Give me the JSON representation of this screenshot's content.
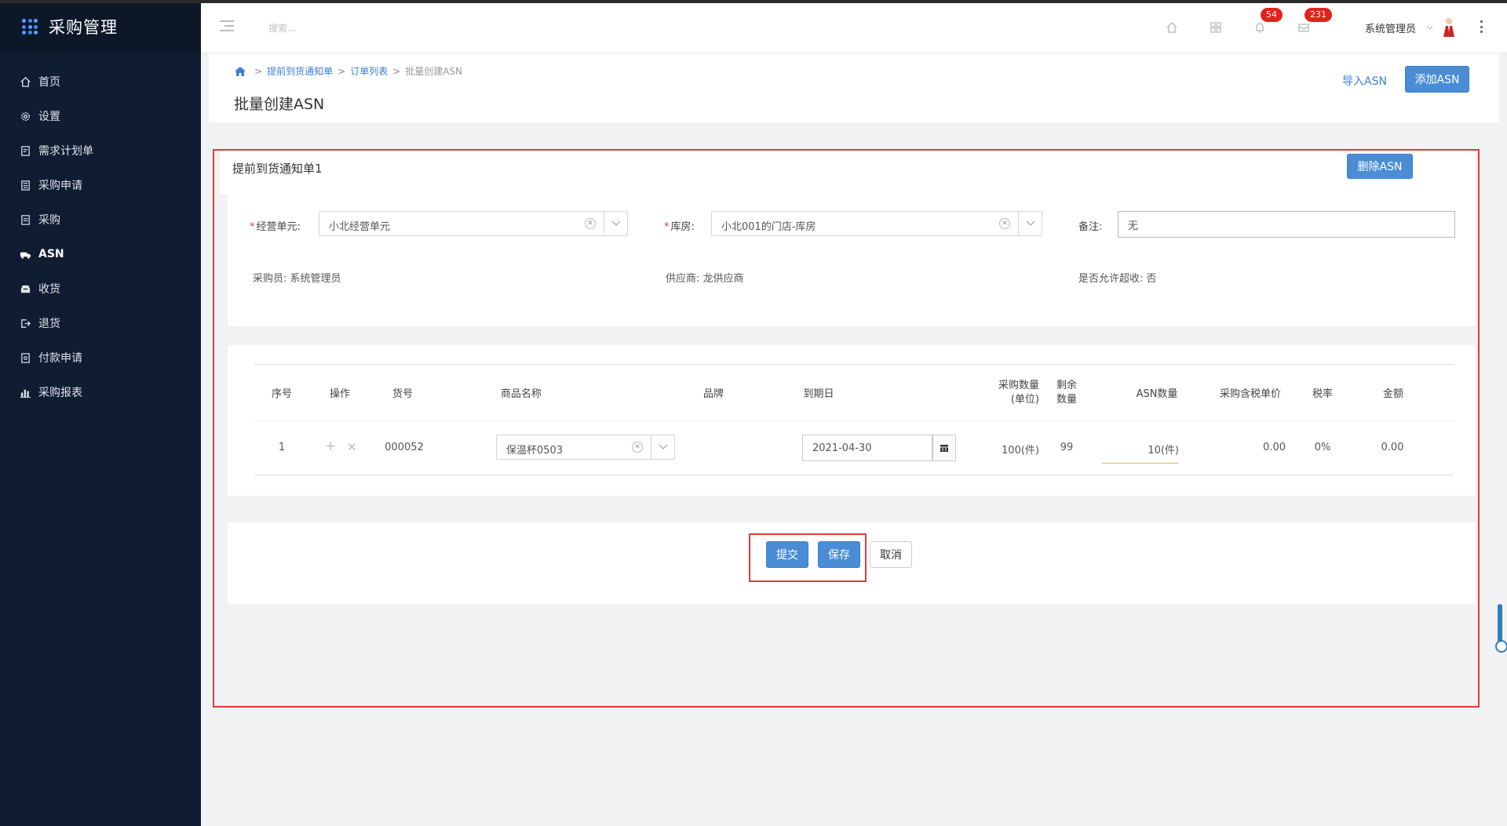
{
  "app": {
    "title": "采购管理"
  },
  "sidebar": {
    "items": [
      {
        "label": "首页",
        "icon": "home-icon"
      },
      {
        "label": "设置",
        "icon": "gear-icon"
      },
      {
        "label": "需求计划单",
        "icon": "edit-doc-icon"
      },
      {
        "label": "采购申请",
        "icon": "list-doc-icon"
      },
      {
        "label": "采购",
        "icon": "doc-icon"
      },
      {
        "label": "ASN",
        "icon": "truck-icon"
      },
      {
        "label": "收货",
        "icon": "inbox-icon"
      },
      {
        "label": "退货",
        "icon": "return-icon"
      },
      {
        "label": "付款申请",
        "icon": "payment-doc-icon"
      },
      {
        "label": "采购报表",
        "icon": "bar-chart-icon"
      }
    ],
    "active_index": 5
  },
  "header": {
    "search_placeholder": "搜索...",
    "notifications_badge": "54",
    "messages_badge": "231",
    "user_name": "系统管理员"
  },
  "title_bar": {
    "breadcrumb": [
      "提前到货通知单",
      "订单列表",
      "批量创建ASN"
    ],
    "page_title": "批量创建ASN",
    "import_label": "导入ASN",
    "add_label": "添加ASN"
  },
  "panel": {
    "title": "提前到货通知单1",
    "delete_label": "删除ASN",
    "form": {
      "business_unit_label": "经营单元:",
      "business_unit_value": "小北经营单元",
      "warehouse_label": "库房:",
      "warehouse_value": "小北001的门店-库房",
      "remark_label": "备注:",
      "remark_value": "无",
      "buyer_label": "采购员:",
      "buyer_value": "系统管理员",
      "supplier_label": "供应商:",
      "supplier_value": "龙供应商",
      "over_receive_label": "是否允许超收:",
      "over_receive_value": "否"
    }
  },
  "table": {
    "headers": {
      "seq": "序号",
      "op": "操作",
      "sku": "货号",
      "name": "商品名称",
      "brand": "品牌",
      "due": "到期日",
      "qty_line1": "采购数量",
      "qty_line2": "(单位)",
      "remain_line1": "剩余",
      "remain_line2": "数量",
      "asn_qty": "ASN数量",
      "price": "采购含税单价",
      "tax": "税率",
      "amount": "金额"
    },
    "rows": [
      {
        "seq": "1",
        "sku": "000052",
        "name": "保温杯0503",
        "brand": "",
        "due": "2021-04-30",
        "qty": "100(件)",
        "remain": "99",
        "asn_qty": "10(件)",
        "price": "0.00",
        "tax": "0%",
        "amount": "0.00"
      }
    ]
  },
  "actions": {
    "submit_label": "提交",
    "save_label": "保存",
    "cancel_label": "取消"
  },
  "colors": {
    "sidebar_bg": "#0f1c31",
    "primary": "#4a8dd6",
    "highlight_border": "#e23a3a",
    "badge": "#e2231a"
  }
}
